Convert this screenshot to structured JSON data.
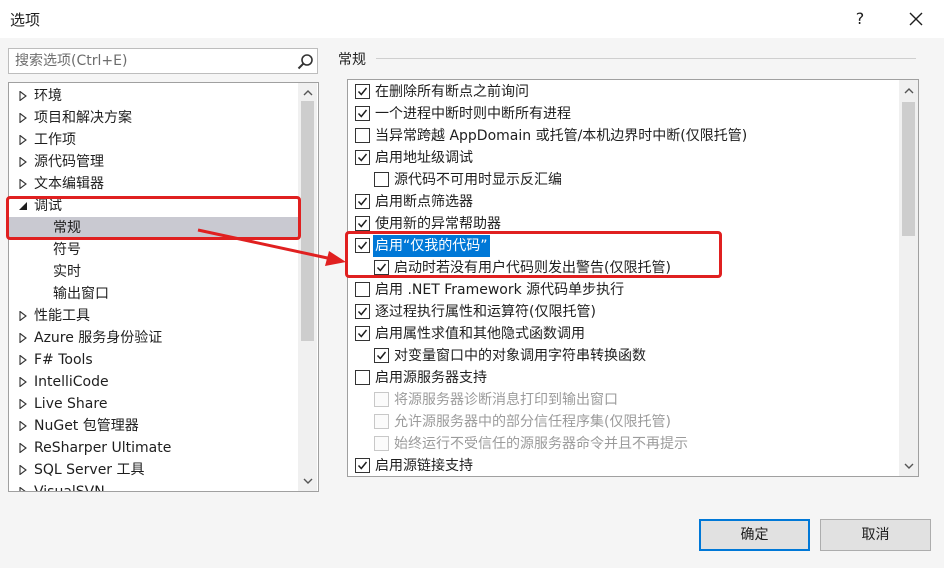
{
  "window": {
    "title": "选项",
    "help_glyph": "?"
  },
  "search": {
    "placeholder": "搜索选项(Ctrl+E)",
    "value": ""
  },
  "tree": {
    "items": [
      {
        "label": "环境",
        "level": 0,
        "expanded": false
      },
      {
        "label": "项目和解决方案",
        "level": 0,
        "expanded": false
      },
      {
        "label": "工作项",
        "level": 0,
        "expanded": false
      },
      {
        "label": "源代码管理",
        "level": 0,
        "expanded": false
      },
      {
        "label": "文本编辑器",
        "level": 0,
        "expanded": false
      },
      {
        "label": "调试",
        "level": 0,
        "expanded": true
      },
      {
        "label": "常规",
        "level": 1,
        "selected": true
      },
      {
        "label": "符号",
        "level": 1
      },
      {
        "label": "实时",
        "level": 1
      },
      {
        "label": "输出窗口",
        "level": 1
      },
      {
        "label": "性能工具",
        "level": 0,
        "expanded": false
      },
      {
        "label": "Azure 服务身份验证",
        "level": 0,
        "expanded": false
      },
      {
        "label": "F# Tools",
        "level": 0,
        "expanded": false
      },
      {
        "label": "IntelliCode",
        "level": 0,
        "expanded": false
      },
      {
        "label": "Live Share",
        "level": 0,
        "expanded": false
      },
      {
        "label": "NuGet 包管理器",
        "level": 0,
        "expanded": false
      },
      {
        "label": "ReSharper Ultimate",
        "level": 0,
        "expanded": false
      },
      {
        "label": "SQL Server 工具",
        "level": 0,
        "expanded": false
      },
      {
        "label": "VisualSVN",
        "level": 0,
        "expanded": false
      }
    ]
  },
  "section": {
    "title": "常规"
  },
  "options": [
    {
      "label": "在删除所有断点之前询问",
      "checked": true,
      "indent": 0
    },
    {
      "label": "一个进程中断时则中断所有进程",
      "checked": true,
      "indent": 0
    },
    {
      "label": "当异常跨越 AppDomain 或托管/本机边界时中断(仅限托管)",
      "checked": false,
      "indent": 0
    },
    {
      "label": "启用地址级调试",
      "checked": true,
      "indent": 0
    },
    {
      "label": "源代码不可用时显示反汇编",
      "checked": false,
      "indent": 1
    },
    {
      "label": "启用断点筛选器",
      "checked": true,
      "indent": 0
    },
    {
      "label": "使用新的异常帮助器",
      "checked": true,
      "indent": 0
    },
    {
      "label": "启用“仅我的代码”",
      "checked": true,
      "indent": 0,
      "selected": true
    },
    {
      "label": "启动时若没有用户代码则发出警告(仅限托管)",
      "checked": true,
      "indent": 1
    },
    {
      "label": "启用 .NET Framework 源代码单步执行",
      "checked": false,
      "indent": 0
    },
    {
      "label": "逐过程执行属性和运算符(仅限托管)",
      "checked": true,
      "indent": 0
    },
    {
      "label": "启用属性求值和其他隐式函数调用",
      "checked": true,
      "indent": 0
    },
    {
      "label": "对变量窗口中的对象调用字符串转换函数",
      "checked": true,
      "indent": 1
    },
    {
      "label": "启用源服务器支持",
      "checked": false,
      "indent": 0
    },
    {
      "label": "将源服务器诊断消息打印到输出窗口",
      "checked": false,
      "indent": 1,
      "disabled": true
    },
    {
      "label": "允许源服务器中的部分信任程序集(仅限托管)",
      "checked": false,
      "indent": 1,
      "disabled": true
    },
    {
      "label": "始终运行不受信任的源服务器命令并且不再提示",
      "checked": false,
      "indent": 1,
      "disabled": true
    },
    {
      "label": "启用源链接支持",
      "checked": true,
      "indent": 0
    }
  ],
  "buttons": {
    "ok": "确定",
    "cancel": "取消"
  },
  "colors": {
    "accent": "#0078d7",
    "annotation": "#e02020",
    "selection": "#c9c9d1"
  }
}
